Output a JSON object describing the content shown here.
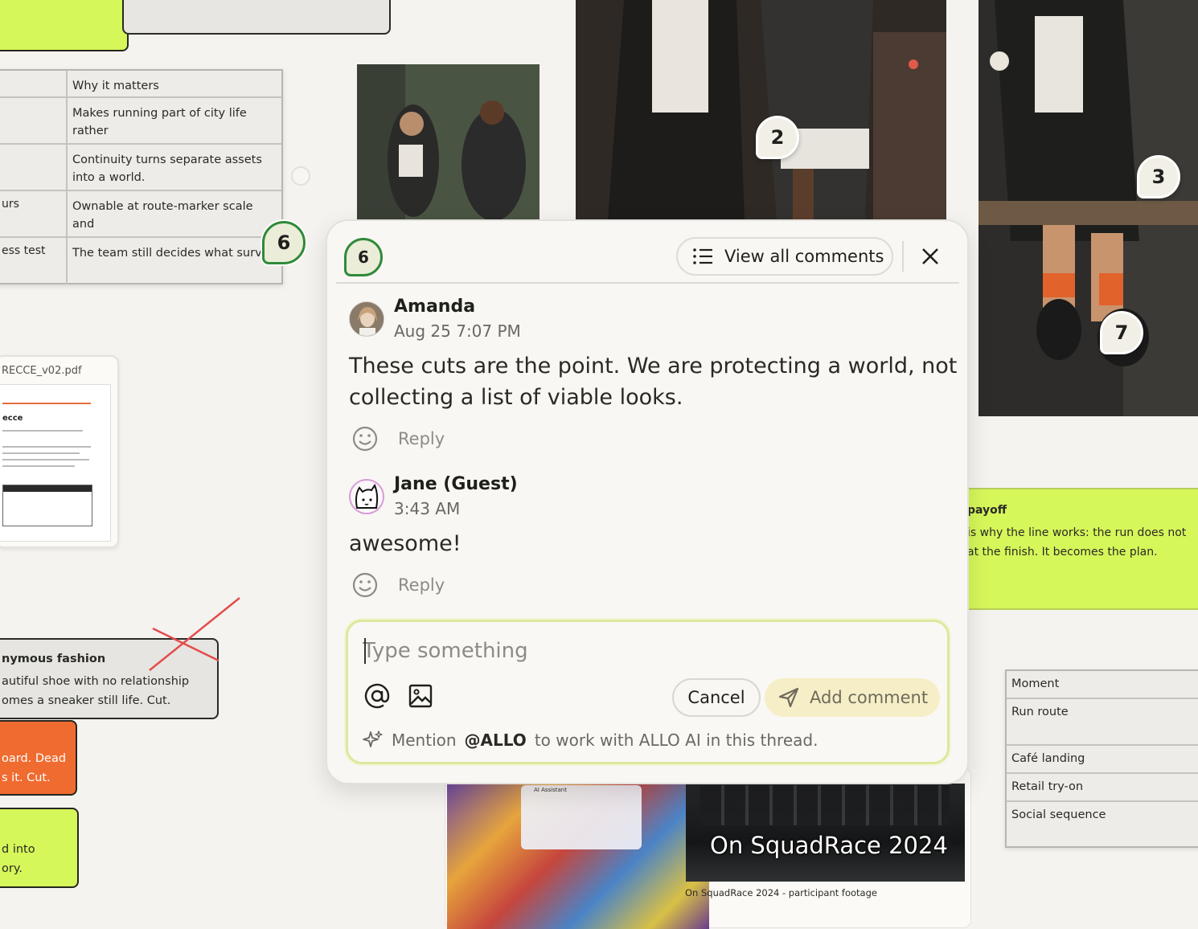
{
  "canvas": {
    "left_table": {
      "rows": [
        {
          "c1": "",
          "c2": "Why it matters"
        },
        {
          "c1": "",
          "c2": "Makes running part of city life rather\nthan a task to finish."
        },
        {
          "c1": "",
          "c2": "Continuity turns separate assets\ninto a world."
        },
        {
          "c1": "urs",
          "c2": "Ownable at route-marker scale and\nproduct scale."
        },
        {
          "c1": "ess test",
          "c2": "The team still decides what surviv"
        }
      ]
    },
    "markers": {
      "m2": "2",
      "m3": "3",
      "m6": "6",
      "m7": "7"
    },
    "pdf": {
      "filename": "RECCE_v02.pdf",
      "doc_title": "ecce"
    },
    "cut_card": {
      "title": "nymous fashion",
      "body": "autiful shoe with no relationship\nomes a sneaker still life. Cut."
    },
    "orange_sticky": {
      "body": "oard. Dead\ns it. Cut."
    },
    "green_sticky": {
      "body": "d into\nory."
    },
    "payoff_sticky": {
      "title": "payoff",
      "body": "is why the line works: the run does not\nat the finish. It becomes the plan."
    },
    "right_table": {
      "rows": [
        "Moment",
        "Run route",
        "Café landing",
        "Retail try-on",
        "Social sequence"
      ]
    },
    "media": {
      "ui_label": "AI Assistant",
      "video_title": "On SquadRace 2024",
      "caption": "On SquadRace 2024 - participant footage"
    }
  },
  "panel": {
    "thread_number": "6",
    "view_all_label": "View all comments",
    "comments": [
      {
        "author": "Amanda",
        "time": "Aug 25 7:07 PM",
        "body": "These cuts are the point. We are protecting a world, not\ncollecting a list of viable looks.",
        "reply_label": "Reply"
      },
      {
        "author": "Jane (Guest)",
        "time": "3:43 AM",
        "body": "awesome!",
        "reply_label": "Reply"
      }
    ],
    "composer": {
      "placeholder": "Type something",
      "cancel_label": "Cancel",
      "add_label": "Add comment",
      "hint_pre": "Mention",
      "hint_mention": "@ALLO",
      "hint_post": "to work with ALLO AI in this thread."
    }
  },
  "colors": {
    "accent_green": "#d6f75a",
    "marker_ring": "#2f8a3a",
    "orange": "#f06b30",
    "add_button_bg": "#f6eec6"
  },
  "icons": [
    "list-icon",
    "close-icon",
    "smiley-icon",
    "at-icon",
    "image-icon",
    "send-icon",
    "sparkle-icon"
  ]
}
